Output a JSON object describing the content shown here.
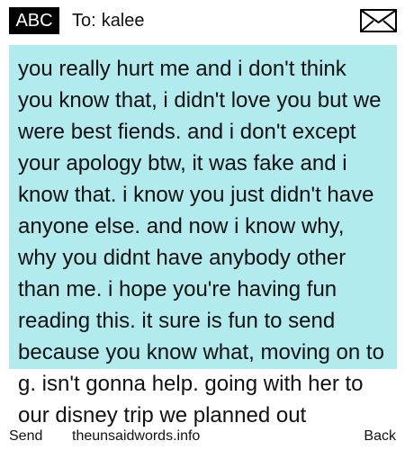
{
  "header": {
    "mode_label": "ABC",
    "recipient_label": "To:",
    "recipient_name": "kalee",
    "icon": "envelope-icon"
  },
  "message": {
    "text": "you really hurt me and i don't think you know that, i didn't love you but we were best fiends. and i don't except your apology btw, it was fake and i know that. i know you just didn't have anyone else. and now i know why, why you didnt have anybody other than me. i hope you're having fun reading this. it sure is fun to send because you know what, moving on to g. isn't gonna help. going with her to our disney trip we planned out"
  },
  "footer": {
    "left_softkey": "Send",
    "site": "theunsaidwords.info",
    "right_softkey": "Back"
  },
  "colors": {
    "message_background": "#b2ebee",
    "badge_background": "#000000",
    "badge_text": "#ffffff",
    "text": "#111111"
  }
}
